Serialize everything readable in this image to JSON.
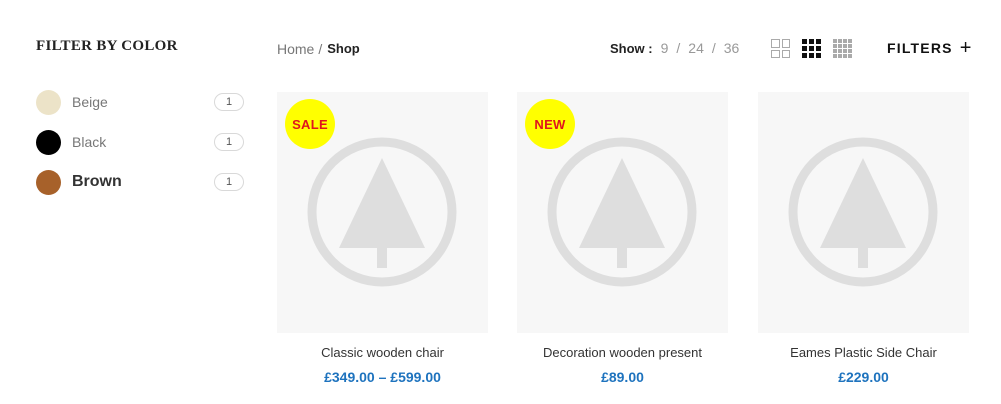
{
  "sidebar": {
    "title": "FILTER BY COLOR",
    "colors": [
      {
        "name": "Beige",
        "count": "1",
        "swatch": "#ece3c8",
        "active": false
      },
      {
        "name": "Black",
        "count": "1",
        "swatch": "#000000",
        "active": false
      },
      {
        "name": "Brown",
        "count": "1",
        "swatch": "#a7612a",
        "active": true
      }
    ]
  },
  "breadcrumb": {
    "home": "Home",
    "separator": "/",
    "current": "Shop"
  },
  "show": {
    "label": "Show :",
    "options": [
      "9",
      "24",
      "36"
    ],
    "separator": "/"
  },
  "view_toggle_icons": [
    "grid-2-icon",
    "grid-3-icon",
    "grid-4-icon"
  ],
  "filters": {
    "label": "FILTERS",
    "icon": "+"
  },
  "colors": {
    "price": "#1e73be",
    "badge_bg": "#ffff00",
    "badge_text": "#e0151d",
    "image_bg": "#f7f7f7"
  },
  "products": [
    {
      "name": "Classic wooden chair",
      "price": "£349.00 – £599.00",
      "badge": "SALE"
    },
    {
      "name": "Decoration wooden present",
      "price": "£89.00",
      "badge": "NEW"
    },
    {
      "name": "Eames Plastic Side Chair",
      "price": "£229.00",
      "badge": ""
    }
  ]
}
